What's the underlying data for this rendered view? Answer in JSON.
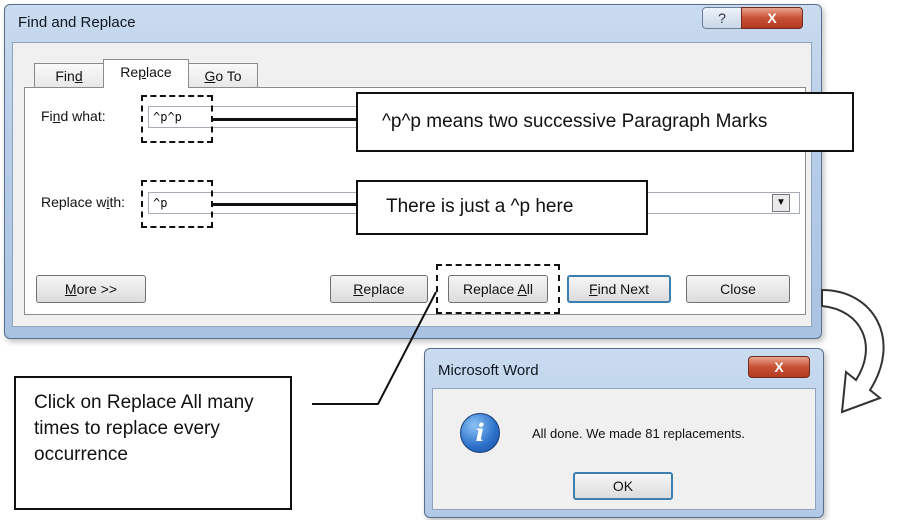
{
  "find_replace": {
    "title": "Find and Replace",
    "help_glyph": "?",
    "close_glyph": "X",
    "tabs": [
      {
        "pre": "Fin",
        "ul": "d",
        "post": ""
      },
      {
        "pre": "Re",
        "ul": "p",
        "post": "lace"
      },
      {
        "pre": "",
        "ul": "G",
        "post": "o To"
      }
    ],
    "find_label": {
      "pre": "Fi",
      "ul": "n",
      "post": "d what:"
    },
    "find_value": "^p^p",
    "replace_label": {
      "pre": "Replace w",
      "ul": "i",
      "post": "th:"
    },
    "replace_value": "^p",
    "dropdown_glyph": "▼",
    "buttons": {
      "more": {
        "pre": "",
        "ul": "M",
        "post": "ore >>"
      },
      "replace": {
        "pre": "",
        "ul": "R",
        "post": "eplace"
      },
      "replace_all": {
        "pre": "Replace ",
        "ul": "A",
        "post": "ll"
      },
      "find_next": {
        "pre": "",
        "ul": "F",
        "post": "ind Next"
      },
      "close": "Close"
    }
  },
  "callouts": {
    "find": "^p^p means two successive Paragraph Marks",
    "replace": "There is just a ^p here",
    "side": "Click on Replace All many times to replace every occurrence"
  },
  "message_box": {
    "title": "Microsoft Word",
    "close_glyph": "X",
    "icon": "info-icon",
    "icon_glyph": "i",
    "message": "All done. We made 81 replacements.",
    "ok": "OK"
  }
}
